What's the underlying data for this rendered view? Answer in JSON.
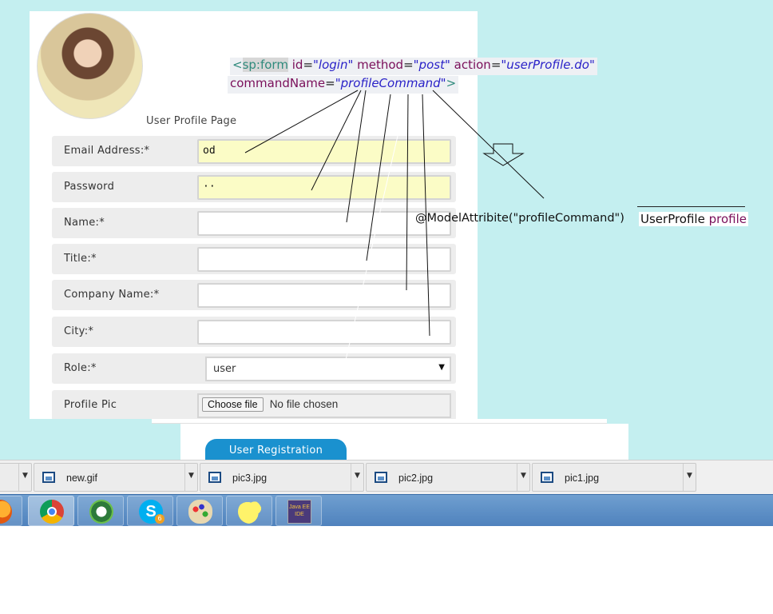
{
  "form": {
    "subtitle": "User Profile Page",
    "fields": [
      {
        "label": "Email Address:*",
        "value": "od"
      },
      {
        "label": "Password",
        "value": "··"
      },
      {
        "label": "Name:*",
        "value": ""
      },
      {
        "label": "Title:*",
        "value": ""
      },
      {
        "label": "Company Name:*",
        "value": ""
      },
      {
        "label": "City:*",
        "value": ""
      }
    ],
    "role": {
      "label": "Role:*",
      "value": "user"
    },
    "profile_pic": {
      "label": "Profile Pic",
      "button": "Choose file",
      "status": "No file chosen"
    },
    "register_button": "User Registration"
  },
  "code_annotation": {
    "line1": {
      "open": "<",
      "tag": "sp:form",
      "attr1": "id",
      "val1": "\"login\"",
      "attr2": "method",
      "val2": "\"post\"",
      "attr3": "action",
      "val3": "\"userProfile.do\""
    },
    "line2": {
      "attr": "commandName",
      "val": "\"profileCommand\"",
      "close": ">"
    },
    "model_attribute": "@ModelAttribite(\"profileCommand\")",
    "param_type": "UserProfile",
    "param_name": "profile"
  },
  "downloads": [
    {
      "name": ""
    },
    {
      "name": "new.gif"
    },
    {
      "name": "pic3.jpg"
    },
    {
      "name": "pic2.jpg"
    },
    {
      "name": "pic1.jpg"
    }
  ],
  "taskbar": {
    "apps": [
      "firefox-icon",
      "chrome-icon",
      "webex-icon",
      "skype-icon",
      "paint-icon",
      "duck-icon",
      "java-ee-ide-icon"
    ],
    "skype_badge": "6",
    "java_label": "Java EE IDE"
  },
  "colors": {
    "background": "#c4eff0",
    "accent": "#1a91cf",
    "filled_input": "#fbfcc6"
  }
}
